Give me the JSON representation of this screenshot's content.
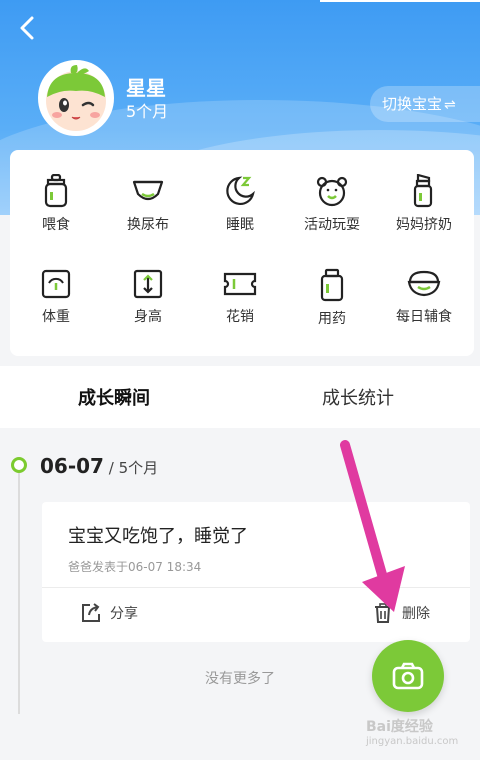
{
  "profile": {
    "name": "星星",
    "age": "5个月"
  },
  "switch_label": "切换宝宝",
  "switch_icon": "swap-icon",
  "actions": [
    {
      "label": "喂食",
      "icon": "bottle-icon"
    },
    {
      "label": "换尿布",
      "icon": "diaper-icon"
    },
    {
      "label": "睡眠",
      "icon": "moon-sleep-icon"
    },
    {
      "label": "活动玩耍",
      "icon": "bear-icon"
    },
    {
      "label": "妈妈挤奶",
      "icon": "breast-pump-icon"
    },
    {
      "label": "体重",
      "icon": "scale-icon"
    },
    {
      "label": "身高",
      "icon": "ruler-icon"
    },
    {
      "label": "花销",
      "icon": "ticket-icon"
    },
    {
      "label": "用药",
      "icon": "medicine-icon"
    },
    {
      "label": "每日辅食",
      "icon": "bowl-icon"
    }
  ],
  "tabs": {
    "moments": "成长瞬间",
    "stats": "成长统计"
  },
  "timeline": {
    "date": "06-07",
    "age": "5个月",
    "post": {
      "text": "宝宝又吃饱了，睡觉了",
      "meta": "爸爸发表于06-07 18:34",
      "share": "分享",
      "delete": "删除"
    },
    "no_more": "没有更多了"
  },
  "watermark": {
    "main": "Bai度经验",
    "sub": "jingyan.baidu.com"
  },
  "colors": {
    "header": "#3e9bf3",
    "accent": "#7cc938",
    "annotation_arrow": "#e03aa0"
  }
}
